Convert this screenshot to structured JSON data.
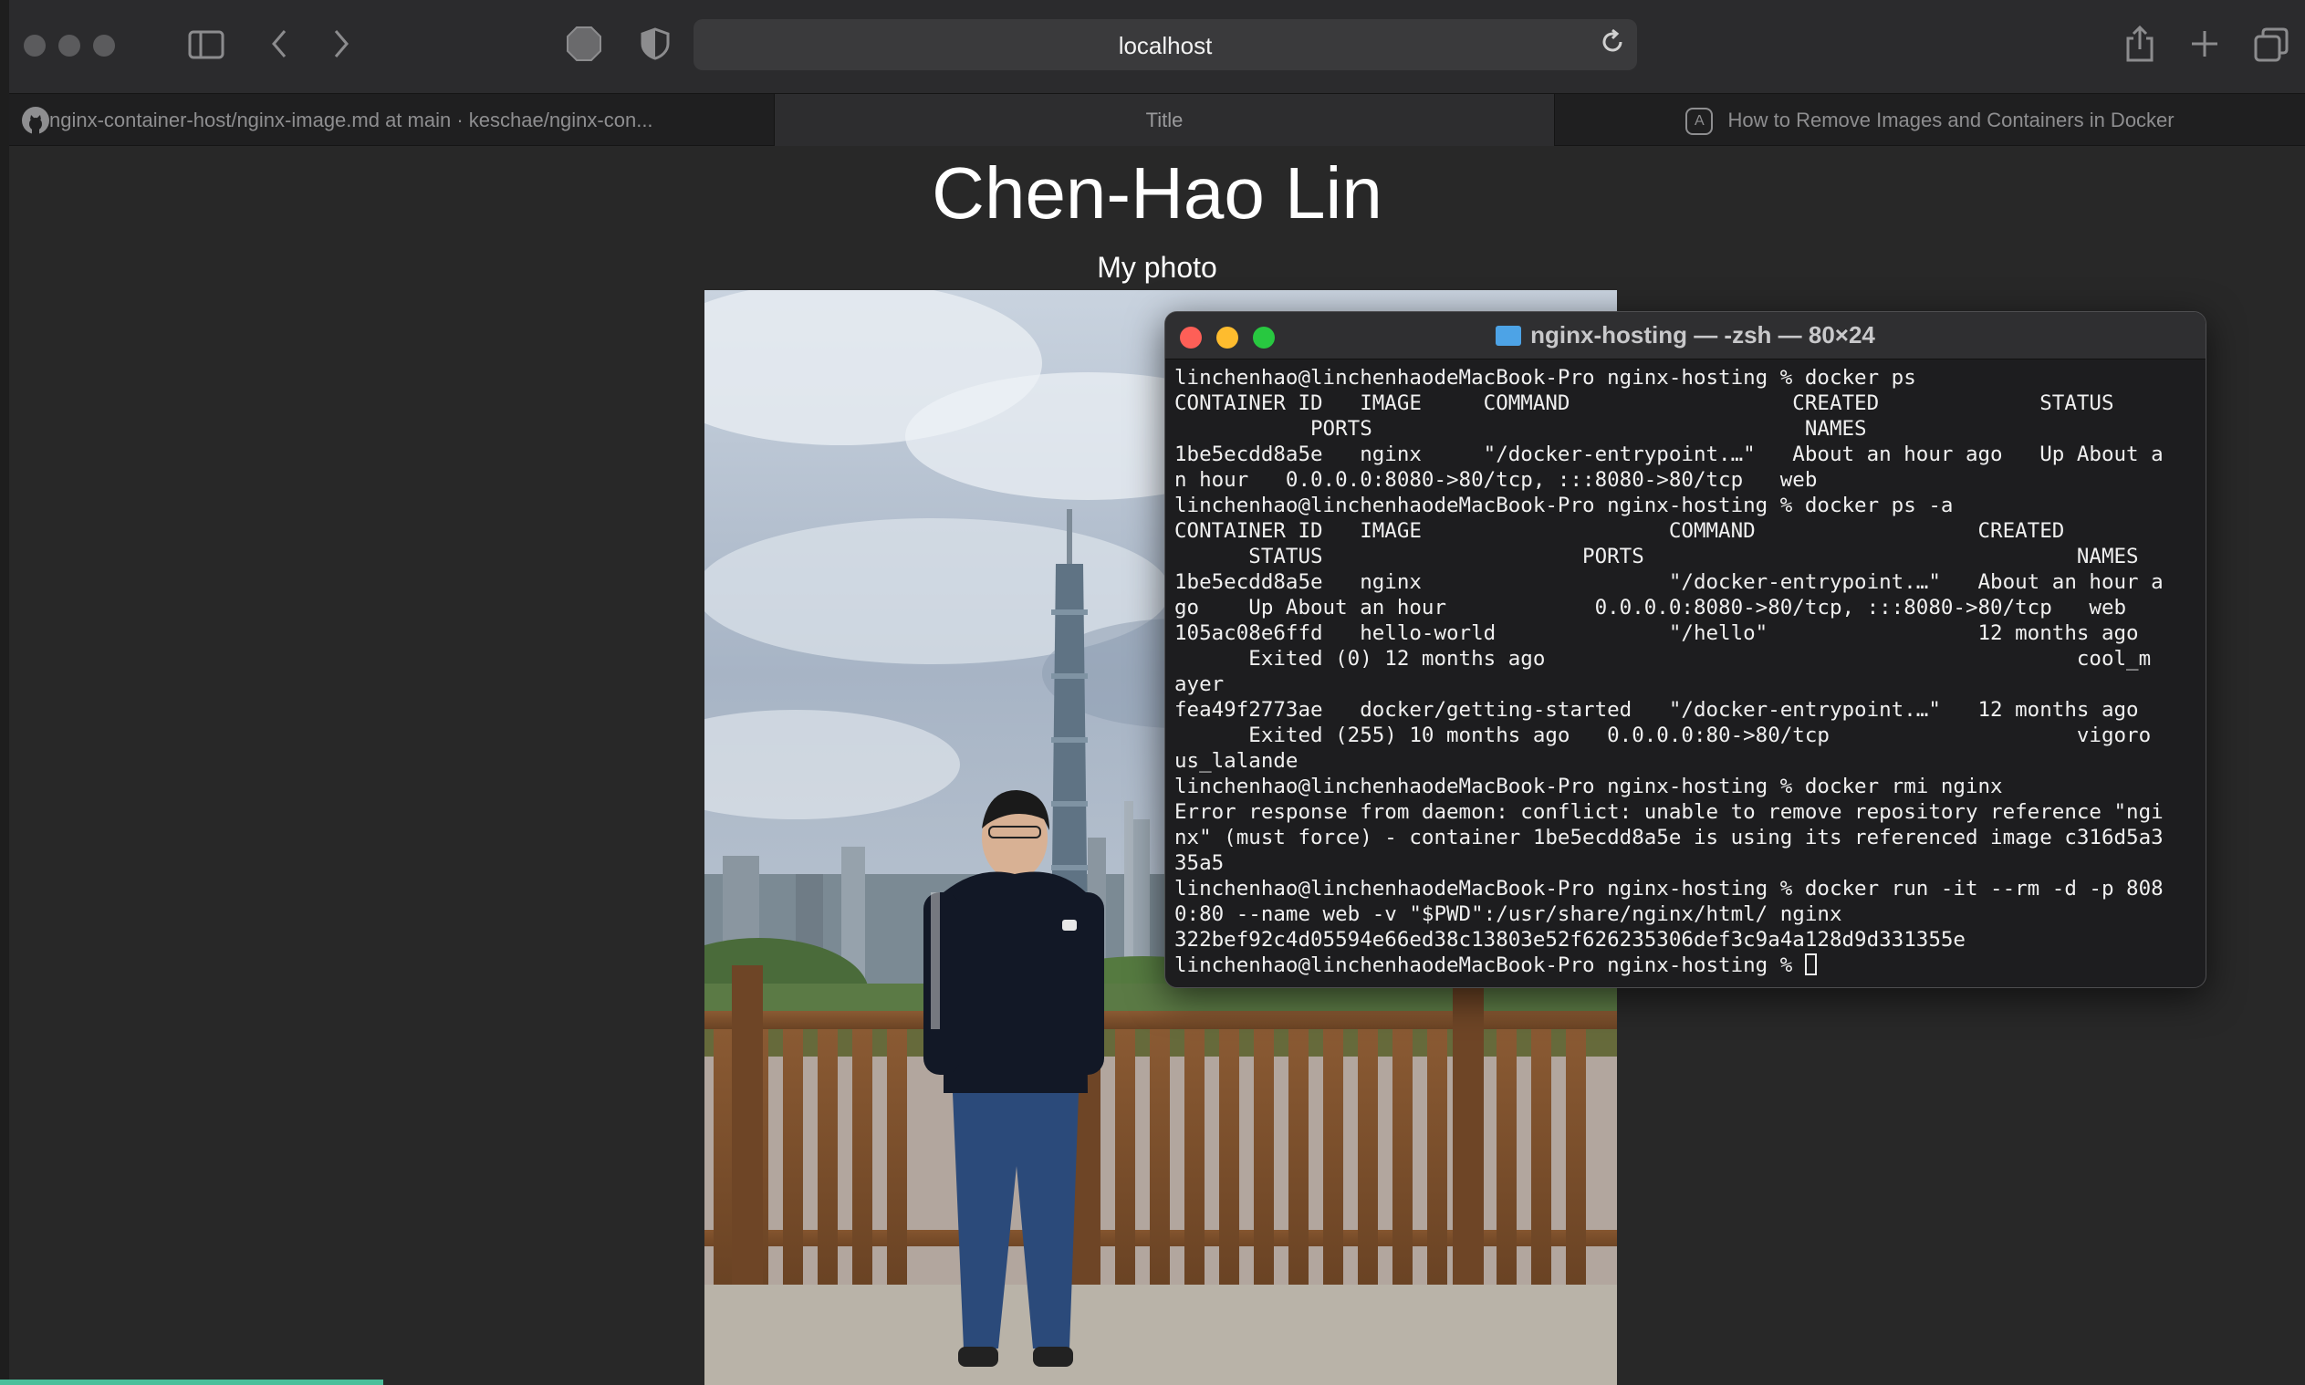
{
  "browser": {
    "url": "localhost",
    "tabs": [
      {
        "label": "nginx-container-host/nginx-image.md at main · keschae/nginx-con..."
      },
      {
        "label": "Title"
      },
      {
        "label": "How to Remove Images and Containers in Docker"
      }
    ]
  },
  "page": {
    "title": "Chen-Hao Lin",
    "subtitle": "My photo"
  },
  "terminal": {
    "title": "nginx-hosting — -zsh — 80×24",
    "lines": [
      "linchenhao@linchenhaodeMacBook-Pro nginx-hosting % docker ps",
      "CONTAINER ID   IMAGE     COMMAND                  CREATED             STATUS",
      "           PORTS                                   NAMES",
      "1be5ecdd8a5e   nginx     \"/docker-entrypoint.…\"   About an hour ago   Up About a",
      "n hour   0.0.0.0:8080->80/tcp, :::8080->80/tcp   web",
      "linchenhao@linchenhaodeMacBook-Pro nginx-hosting % docker ps -a",
      "CONTAINER ID   IMAGE                    COMMAND                  CREATED",
      "      STATUS                     PORTS                                   NAMES",
      "1be5ecdd8a5e   nginx                    \"/docker-entrypoint.…\"   About an hour a",
      "go    Up About an hour            0.0.0.0:8080->80/tcp, :::8080->80/tcp   web",
      "105ac08e6ffd   hello-world              \"/hello\"                 12 months ago",
      "      Exited (0) 12 months ago                                           cool_m",
      "ayer",
      "fea49f2773ae   docker/getting-started   \"/docker-entrypoint.…\"   12 months ago",
      "      Exited (255) 10 months ago   0.0.0.0:80->80/tcp                    vigoro",
      "us_lalande",
      "linchenhao@linchenhaodeMacBook-Pro nginx-hosting % docker rmi nginx",
      "Error response from daemon: conflict: unable to remove repository reference \"ngi",
      "nx\" (must force) - container 1be5ecdd8a5e is using its referenced image c316d5a3",
      "35a5",
      "linchenhao@linchenhaodeMacBook-Pro nginx-hosting % docker run -it --rm -d -p 808",
      "0:80 --name web -v \"$PWD\":/usr/share/nginx/html/ nginx",
      "322bef92c4d05594e66ed38c13803e52f626235306def3c9a4a128d9d331355e",
      "linchenhao@linchenhaodeMacBook-Pro nginx-hosting % "
    ]
  },
  "colors": {
    "close": "#fe5f57",
    "minimize": "#febc2e",
    "zoom": "#28c840",
    "background": "#282828"
  },
  "icons": [
    "sidebar-icon",
    "back-icon",
    "forward-icon",
    "privacy-icon",
    "shield-icon",
    "reload-icon",
    "share-icon",
    "new-tab-icon",
    "tab-overview-icon",
    "github-icon",
    "site-icon",
    "folder-icon"
  ]
}
